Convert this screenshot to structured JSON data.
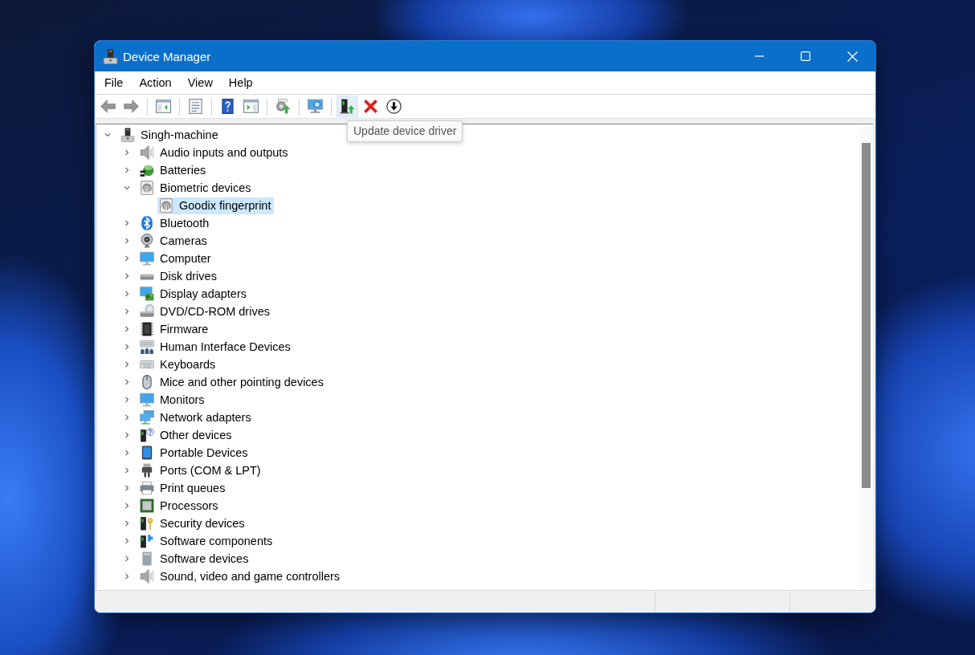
{
  "window": {
    "title": "Device Manager"
  },
  "menu": [
    "File",
    "Action",
    "View",
    "Help"
  ],
  "toolbar": [
    [
      {
        "kind": "back",
        "disabled": true,
        "hovered": false
      },
      {
        "kind": "forward",
        "disabled": true,
        "hovered": false
      }
    ],
    [
      {
        "kind": "console_tree",
        "disabled": false,
        "hovered": false
      }
    ],
    [
      {
        "kind": "properties",
        "disabled": false,
        "hovered": false
      }
    ],
    [
      {
        "kind": "help",
        "disabled": false,
        "hovered": false
      },
      {
        "kind": "action_pane",
        "disabled": false,
        "hovered": false
      }
    ],
    [
      {
        "kind": "scan",
        "disabled": false,
        "hovered": false
      }
    ],
    [
      {
        "kind": "monitor",
        "disabled": false,
        "hovered": false
      }
    ],
    [
      {
        "kind": "update_driver",
        "disabled": false,
        "hovered": true
      },
      {
        "kind": "uninstall",
        "disabled": false,
        "hovered": false
      },
      {
        "kind": "disable",
        "disabled": false,
        "hovered": false
      }
    ]
  ],
  "tooltip": {
    "text": "Update device driver"
  },
  "tree": {
    "label": "Singh-machine",
    "kind": "computer",
    "expanded": true,
    "selected": false,
    "children": [
      {
        "label": "Audio inputs and outputs",
        "kind": "audio",
        "expanded": false,
        "selected": false
      },
      {
        "label": "Batteries",
        "kind": "battery",
        "expanded": false,
        "selected": false
      },
      {
        "label": "Biometric devices",
        "kind": "biometric",
        "expanded": true,
        "selected": false,
        "children": [
          {
            "label": "Goodix fingerprint",
            "kind": "fingerprint",
            "selected": true
          }
        ]
      },
      {
        "label": "Bluetooth",
        "kind": "bluetooth",
        "expanded": false,
        "selected": false
      },
      {
        "label": "Cameras",
        "kind": "camera",
        "expanded": false,
        "selected": false
      },
      {
        "label": "Computer",
        "kind": "pc",
        "expanded": false,
        "selected": false
      },
      {
        "label": "Disk drives",
        "kind": "disk",
        "expanded": false,
        "selected": false
      },
      {
        "label": "Display adapters",
        "kind": "display",
        "expanded": false,
        "selected": false
      },
      {
        "label": "DVD/CD-ROM drives",
        "kind": "dvd",
        "expanded": false,
        "selected": false
      },
      {
        "label": "Firmware",
        "kind": "firmware",
        "expanded": false,
        "selected": false
      },
      {
        "label": "Human Interface Devices",
        "kind": "hid",
        "expanded": false,
        "selected": false
      },
      {
        "label": "Keyboards",
        "kind": "keyboard",
        "expanded": false,
        "selected": false
      },
      {
        "label": "Mice and other pointing devices",
        "kind": "mouse",
        "expanded": false,
        "selected": false
      },
      {
        "label": "Monitors",
        "kind": "monitor",
        "expanded": false,
        "selected": false
      },
      {
        "label": "Network adapters",
        "kind": "network",
        "expanded": false,
        "selected": false
      },
      {
        "label": "Other devices",
        "kind": "other",
        "expanded": false,
        "selected": false
      },
      {
        "label": "Portable Devices",
        "kind": "portable",
        "expanded": false,
        "selected": false
      },
      {
        "label": "Ports (COM & LPT)",
        "kind": "ports",
        "expanded": false,
        "selected": false
      },
      {
        "label": "Print queues",
        "kind": "printer",
        "expanded": false,
        "selected": false
      },
      {
        "label": "Processors",
        "kind": "processor",
        "expanded": false,
        "selected": false
      },
      {
        "label": "Security devices",
        "kind": "security",
        "expanded": false,
        "selected": false
      },
      {
        "label": "Software components",
        "kind": "software_component",
        "expanded": false,
        "selected": false
      },
      {
        "label": "Software devices",
        "kind": "software_device",
        "expanded": false,
        "selected": false
      },
      {
        "label": "Sound, video and game controllers",
        "kind": "sound",
        "expanded": false,
        "selected": false
      }
    ]
  }
}
